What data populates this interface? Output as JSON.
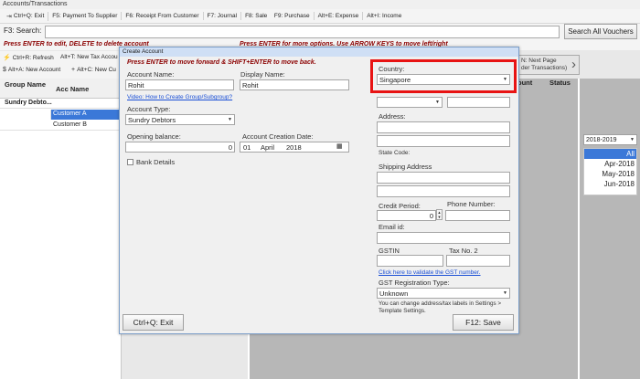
{
  "window": {
    "title": "Accounts/Transactions"
  },
  "toolbar": {
    "items": [
      {
        "label": "Ctrl+Q: Exit"
      },
      {
        "label": "F5: Payment To Supplier"
      },
      {
        "label": "F6: Receipt From Customer"
      },
      {
        "label": "F7: Journal"
      },
      {
        "label": "F8: Sale"
      },
      {
        "label": "F9: Purchase"
      },
      {
        "label": "Alt+E: Expense"
      },
      {
        "label": "Alt+I: Income"
      }
    ]
  },
  "search": {
    "label": "F3: Search:",
    "value": "",
    "button": "Search All Vouchers"
  },
  "hints": {
    "left": "Press ENTER to edit, DELETE to delete account",
    "right": "Press ENTER for more options. Use ARROW KEYS to move left/right"
  },
  "actions": {
    "refresh": "Ctrl+R: Refresh",
    "new_tax": "Alt+T: New Tax Accou",
    "new_account": "Alt+A: New Account",
    "new_cu": "Alt+C: New Cu"
  },
  "accounts_grid": {
    "headers": {
      "group": "Group Name",
      "acc": "Acc Name"
    },
    "group_row": "Sundry Debto...",
    "rows": [
      "Customer A",
      "Customer B"
    ]
  },
  "transactions_grid": {
    "headers": {
      "amount": "ount",
      "status": "Status"
    },
    "next_page": {
      "line1": "N: Next Page",
      "line2": "der Transactions)"
    }
  },
  "period": {
    "year": "2018-2019",
    "items": [
      "All",
      "Apr-2018",
      "May-2018",
      "Jun-2018"
    ]
  },
  "dialog": {
    "title": "Create Account",
    "hint": "Press ENTER to move forward & SHIFT+ENTER to move back.",
    "account_name": {
      "label": "Account Name:",
      "value": "Rohit"
    },
    "display_name": {
      "label": "Display Name:",
      "value": "Rohit"
    },
    "video_link": "Video: How to Create Group/Subgroup?",
    "account_type": {
      "label": "Account Type:",
      "value": "Sundry Debtors"
    },
    "opening_balance": {
      "label": "Opening balance:",
      "value": "0"
    },
    "creation_date": {
      "label": "Account Creation Date:",
      "day": "01",
      "month": "April",
      "year": "2018"
    },
    "bank_details": "Bank Details",
    "country": {
      "label": "Country:",
      "value": "Singapore"
    },
    "address": {
      "label": "Address:"
    },
    "state_code": "State Code:",
    "shipping_address": "Shipping Address",
    "credit_period": {
      "label": "Credit Period:",
      "value": "0"
    },
    "phone": {
      "label": "Phone Number:"
    },
    "email": {
      "label": "Email id:"
    },
    "gstin": {
      "label": "GSTIN"
    },
    "tax_no2": {
      "label": "Tax No. 2"
    },
    "gst_link": "Click here to validate the GST number.",
    "gst_reg": {
      "label": "GST Registration Type:",
      "value": "Unknown"
    },
    "note": "You can change address/tax labels in Settings > Template Settings.",
    "exit_button": "Ctrl+Q: Exit",
    "save_button": "F12: Save"
  },
  "colors": {
    "accent": "#3b78d8",
    "hint_red": "#8b0000",
    "highlight": "#e81313"
  }
}
